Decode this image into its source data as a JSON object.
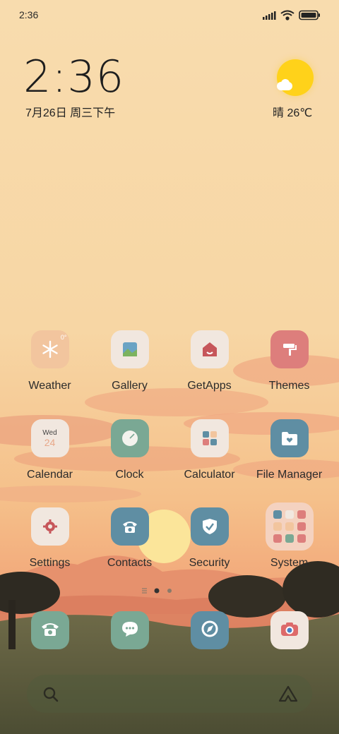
{
  "status_bar": {
    "time": "2:36"
  },
  "clock_widget": {
    "time": "2:36",
    "date": "7月26日 周三下午"
  },
  "weather_widget": {
    "text": "晴 26℃",
    "icon": "sun-cloud-icon"
  },
  "apps": [
    {
      "label": "Weather",
      "icon": "snowflake-icon",
      "badge": "0°"
    },
    {
      "label": "Gallery",
      "icon": "image-icon"
    },
    {
      "label": "GetApps",
      "icon": "store-icon"
    },
    {
      "label": "Themes",
      "icon": "paint-roller-icon"
    },
    {
      "label": "Calendar",
      "icon": "calendar-icon",
      "day": "Wed",
      "date": "24"
    },
    {
      "label": "Clock",
      "icon": "clock-icon"
    },
    {
      "label": "Calculator",
      "icon": "calculator-icon"
    },
    {
      "label": "File Manager",
      "icon": "folder-icon"
    },
    {
      "label": "Settings",
      "icon": "gear-icon"
    },
    {
      "label": "Contacts",
      "icon": "phone-book-icon"
    },
    {
      "label": "Security",
      "icon": "shield-icon"
    },
    {
      "label": "System",
      "icon": "folder-grid-icon"
    }
  ],
  "dock": [
    {
      "icon": "phone-icon"
    },
    {
      "icon": "message-icon"
    },
    {
      "icon": "browser-icon"
    },
    {
      "icon": "camera-icon"
    }
  ],
  "page_indicator": {
    "pages": 2,
    "current": 1
  },
  "colors": {
    "tile_peach": "#f2c59e",
    "tile_light": "#f1e7df",
    "tile_rose": "#dd7e7c",
    "tile_teal": "#5f8ea3",
    "tile_green": "#7aa894",
    "sun": "#ffd21a"
  }
}
